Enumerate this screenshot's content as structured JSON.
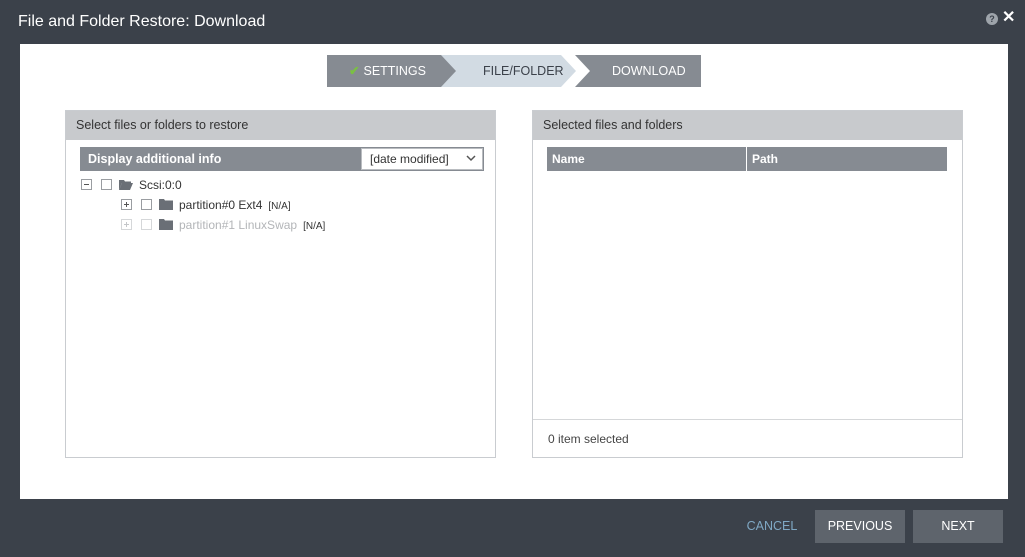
{
  "dialog": {
    "title": "File and Folder Restore: Download",
    "help_icon": "question-circle-icon",
    "help_glyph": "?",
    "close_icon": "close-icon",
    "close_glyph": "✕"
  },
  "wizard": {
    "steps": [
      {
        "label": "SETTINGS",
        "state": "completed",
        "check_glyph": "✔"
      },
      {
        "label": "FILE/FOLDER",
        "state": "active"
      },
      {
        "label": "DOWNLOAD",
        "state": "pending"
      }
    ],
    "colors": {
      "completed": "#868b92",
      "active": "#d2dbe3",
      "pending": "#868b92",
      "check": "#7bc043"
    }
  },
  "left_panel": {
    "title": "Select files or folders to restore",
    "info_label": "Display additional info",
    "info_select_value": "[date modified]",
    "tree": [
      {
        "label": "Scsi:0:0",
        "expander": "minus",
        "icon": "folder-open-icon",
        "tag": "",
        "disabled": false
      },
      {
        "label": "partition#0 Ext4",
        "expander": "plus",
        "icon": "folder-icon",
        "tag": "[N/A]",
        "disabled": false
      },
      {
        "label": "partition#1 LinuxSwap",
        "expander": "plus",
        "icon": "folder-icon",
        "tag": "[N/A]",
        "disabled": true
      }
    ]
  },
  "right_panel": {
    "title": "Selected files and folders",
    "columns": [
      "Name",
      "Path"
    ],
    "rows": [],
    "status": "0 item selected"
  },
  "footer": {
    "cancel_label": "CANCEL",
    "previous_label": "PREVIOUS",
    "next_label": "NEXT"
  }
}
